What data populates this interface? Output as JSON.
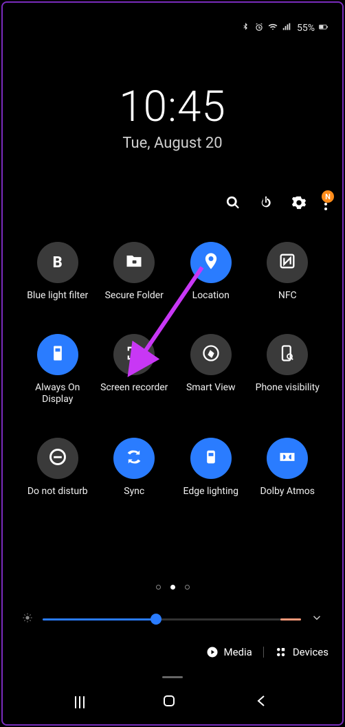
{
  "status": {
    "battery_pct": "55%",
    "icons": [
      "bluetooth",
      "alarm",
      "wifi",
      "signal"
    ]
  },
  "clock": {
    "time": "10:45",
    "date": "Tue, August 20"
  },
  "header": {
    "badge": "N"
  },
  "tiles": [
    {
      "id": "blue-light-filter",
      "label": "Blue light filter",
      "active": false,
      "icon": "blue-light"
    },
    {
      "id": "secure-folder",
      "label": "Secure Folder",
      "active": false,
      "icon": "folder-lock"
    },
    {
      "id": "location",
      "label": "Location",
      "active": true,
      "icon": "pin"
    },
    {
      "id": "nfc",
      "label": "NFC",
      "active": false,
      "icon": "nfc"
    },
    {
      "id": "always-on-display",
      "label": "Always On Display",
      "active": true,
      "icon": "aod"
    },
    {
      "id": "screen-recorder",
      "label": "Screen recorder",
      "active": false,
      "icon": "screenrec"
    },
    {
      "id": "smart-view",
      "label": "Smart View",
      "active": false,
      "icon": "smartview"
    },
    {
      "id": "phone-visibility",
      "label": "Phone visibility",
      "active": false,
      "icon": "phonevis"
    },
    {
      "id": "do-not-disturb",
      "label": "Do not disturb",
      "active": false,
      "icon": "dnd"
    },
    {
      "id": "sync",
      "label": "Sync",
      "active": true,
      "icon": "sync"
    },
    {
      "id": "edge-lighting",
      "label": "Edge lighting",
      "active": true,
      "icon": "edge"
    },
    {
      "id": "dolby-atmos",
      "label": "Dolby Atmos",
      "active": true,
      "icon": "dolby"
    }
  ],
  "pager": {
    "count": 3,
    "active": 1
  },
  "brightness": {
    "pct": 44
  },
  "bottom": {
    "media": "Media",
    "devices": "Devices"
  },
  "annotation": {
    "arrow_color": "#c837f5"
  }
}
